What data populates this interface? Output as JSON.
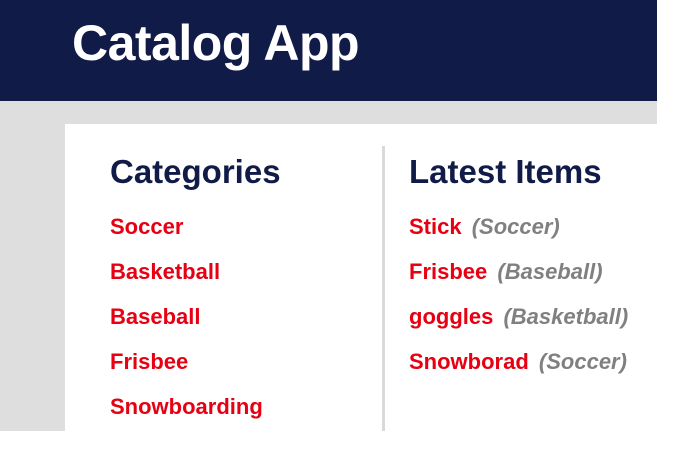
{
  "app": {
    "title": "Catalog App"
  },
  "categories": {
    "heading": "Categories",
    "items": [
      {
        "label": "Soccer"
      },
      {
        "label": "Basketball"
      },
      {
        "label": "Baseball"
      },
      {
        "label": "Frisbee"
      },
      {
        "label": "Snowboarding"
      }
    ]
  },
  "latest": {
    "heading": "Latest Items",
    "items": [
      {
        "label": "Stick",
        "category": "(Soccer)"
      },
      {
        "label": "Frisbee",
        "category": "(Baseball)"
      },
      {
        "label": "goggles",
        "category": "(Basketball)"
      },
      {
        "label": "Snowborad",
        "category": "(Soccer)"
      }
    ]
  },
  "colors": {
    "header_bg": "#111b48",
    "heading_text": "#111b48",
    "link": "#e60012",
    "category_tag": "#808080",
    "page_bg": "#dedede",
    "panel_bg": "#ffffff",
    "divider": "#d9d9d9"
  }
}
